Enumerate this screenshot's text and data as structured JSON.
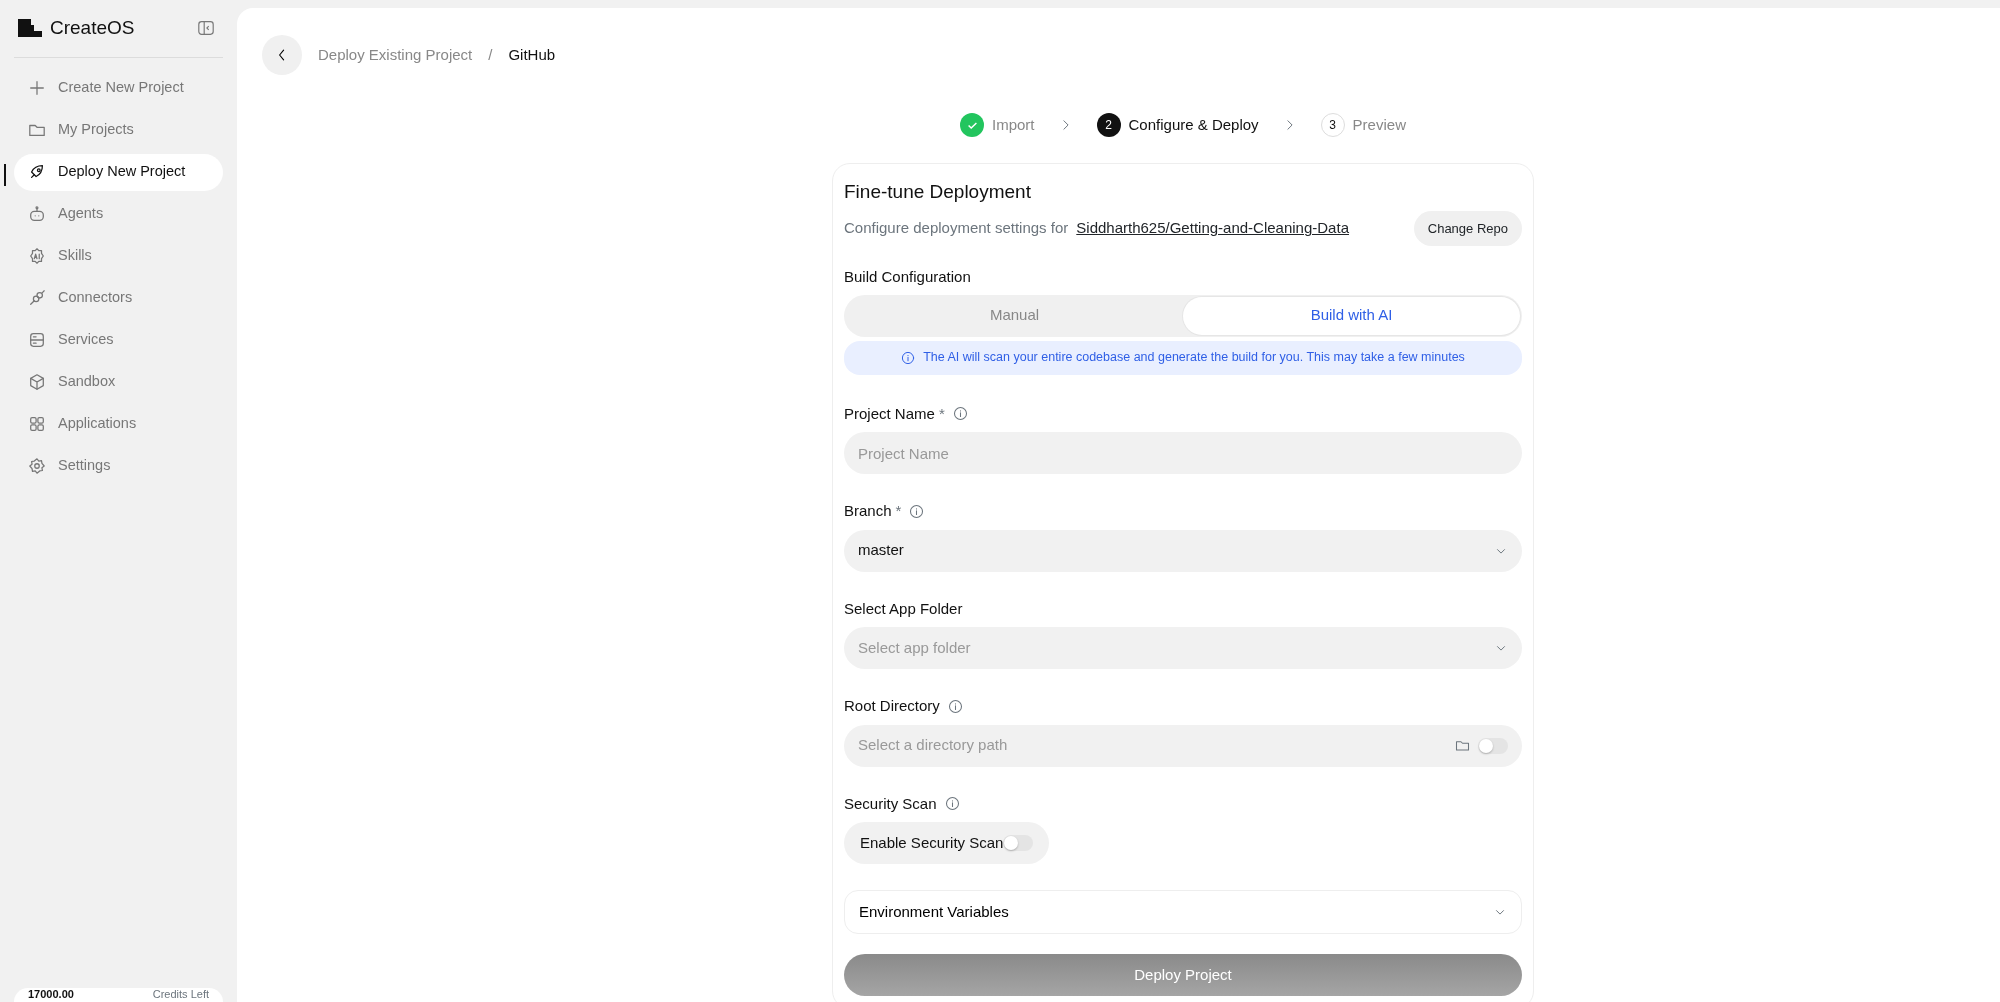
{
  "sidebar": {
    "logo_text": "CreateOS",
    "items": [
      {
        "label": "Create New Project",
        "selected": false
      },
      {
        "label": "My Projects",
        "selected": false
      },
      {
        "label": "Deploy New Project",
        "selected": true
      },
      {
        "label": "Agents",
        "selected": false
      },
      {
        "label": "Skills",
        "selected": false
      },
      {
        "label": "Connectors",
        "selected": false
      },
      {
        "label": "Services",
        "selected": false
      },
      {
        "label": "Sandbox",
        "selected": false
      },
      {
        "label": "Applications",
        "selected": false
      },
      {
        "label": "Settings",
        "selected": false
      }
    ],
    "credits": {
      "amount": "17000.00",
      "label": "Credits Left"
    }
  },
  "breadcrumb": {
    "items": [
      "Deploy Existing Project",
      "GitHub"
    ],
    "separator": "/"
  },
  "stepper": [
    {
      "kind": "done",
      "label": "Import"
    },
    {
      "kind": "current",
      "number": "2",
      "label": "Configure & Deploy"
    },
    {
      "kind": "upcoming",
      "number": "3",
      "label": "Preview"
    }
  ],
  "card": {
    "title": "Fine-tune Deployment",
    "subtitle": "Configure deployment settings for",
    "repo": "Siddharth625/Getting-and-Cleaning-Data",
    "change_button": "Change Repo",
    "build_config": {
      "label": "Build Configuration",
      "options": [
        {
          "label": "Manual",
          "selected": false
        },
        {
          "label": "Build with AI",
          "selected": true
        }
      ],
      "info": "The AI will scan your entire codebase and generate the build for you. This may take a few minutes"
    },
    "fields": [
      {
        "kind": "input",
        "label": "Project Name",
        "required_mark": "*",
        "info": true,
        "placeholder": "Project Name"
      },
      {
        "kind": "select",
        "label": "Branch",
        "required_mark": "*",
        "info": true,
        "value": "master"
      },
      {
        "kind": "select",
        "label": "Select App Folder",
        "info": false,
        "placeholder": "Select app folder"
      },
      {
        "kind": "path",
        "label": "Root Directory",
        "info": true,
        "placeholder": "Select a directory path",
        "on": false
      },
      {
        "kind": "toggle",
        "label": "Security Scan",
        "info": true,
        "toggle_label": "Enable Security Scan",
        "on": false
      }
    ],
    "env": {
      "label": "Environment Variables",
      "expanded": false
    },
    "deploy_button": {
      "label": "Deploy Project",
      "disabled": true
    }
  }
}
